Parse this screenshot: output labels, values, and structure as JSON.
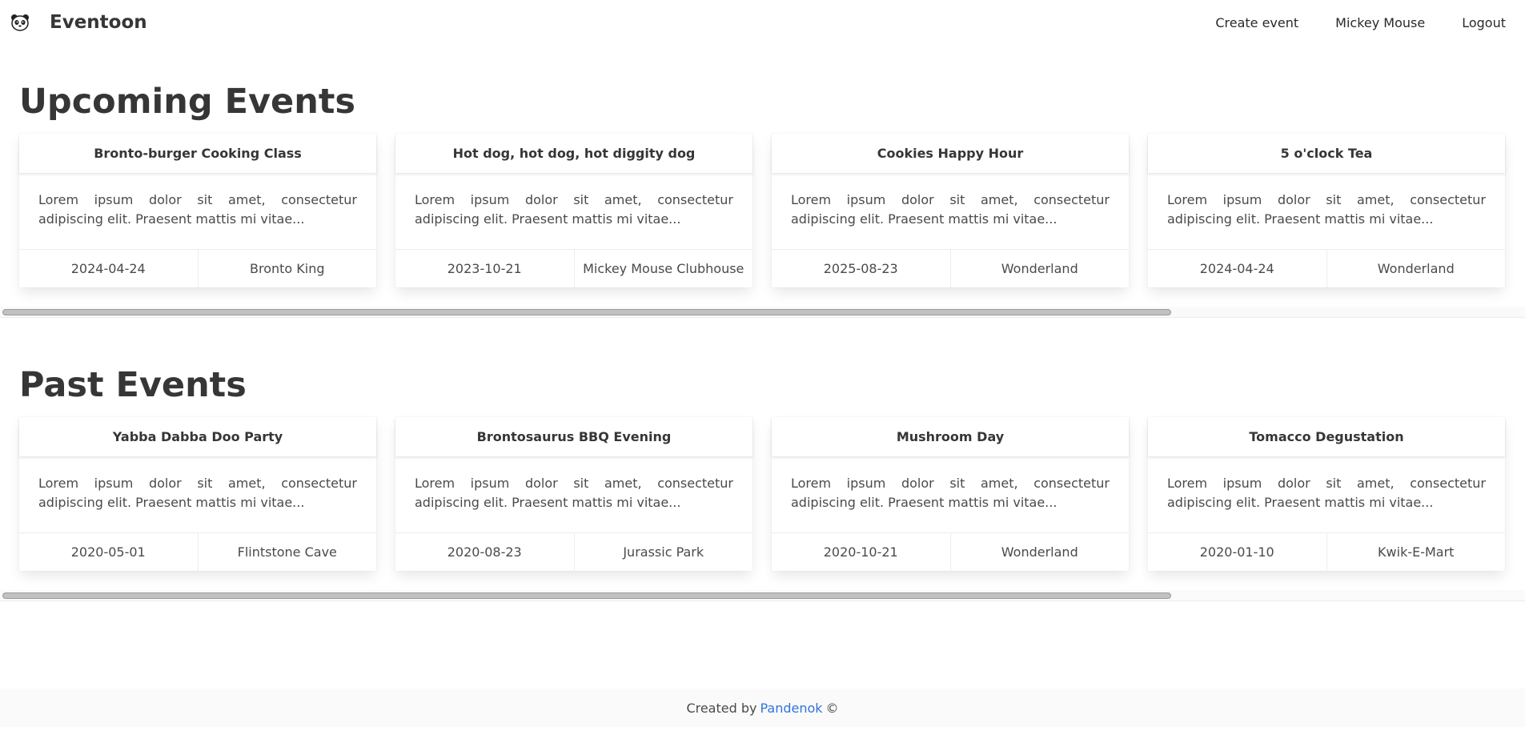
{
  "app": {
    "name": "Eventoon",
    "logo_icon": "panda-icon"
  },
  "nav": {
    "create_event": "Create event",
    "user": "Mickey Mouse",
    "logout": "Logout"
  },
  "upcoming": {
    "title": "Upcoming Events",
    "events": [
      {
        "title": "Bronto-burger Cooking Class",
        "description": "Lorem ipsum dolor sit amet, consectetur adipiscing elit. Praesent mattis mi vitae...",
        "date": "2024-04-24",
        "location": "Bronto King"
      },
      {
        "title": "Hot dog, hot dog, hot diggity dog",
        "description": "Lorem ipsum dolor sit amet, consectetur adipiscing elit. Praesent mattis mi vitae...",
        "date": "2023-10-21",
        "location": "Mickey Mouse Clubhouse"
      },
      {
        "title": "Cookies Happy Hour",
        "description": "Lorem ipsum dolor sit amet, consectetur adipiscing elit. Praesent mattis mi vitae...",
        "date": "2025-08-23",
        "location": "Wonderland"
      },
      {
        "title": "5 o'clock Tea",
        "description": "Lorem ipsum dolor sit amet, consectetur adipiscing elit. Praesent mattis mi vitae...",
        "date": "2024-04-24",
        "location": "Wonderland"
      }
    ]
  },
  "past": {
    "title": "Past Events",
    "events": [
      {
        "title": "Yabba Dabba Doo Party",
        "description": "Lorem ipsum dolor sit amet, consectetur adipiscing elit. Praesent mattis mi vitae...",
        "date": "2020-05-01",
        "location": "Flintstone Cave"
      },
      {
        "title": "Brontosaurus BBQ Evening",
        "description": "Lorem ipsum dolor sit amet, consectetur adipiscing elit. Praesent mattis mi vitae...",
        "date": "2020-08-23",
        "location": "Jurassic Park"
      },
      {
        "title": "Mushroom Day",
        "description": "Lorem ipsum dolor sit amet, consectetur adipiscing elit. Praesent mattis mi vitae...",
        "date": "2020-10-21",
        "location": "Wonderland"
      },
      {
        "title": "Tomacco Degustation",
        "description": "Lorem ipsum dolor sit amet, consectetur adipiscing elit. Praesent mattis mi vitae...",
        "date": "2020-01-10",
        "location": "Kwik-E-Mart"
      }
    ]
  },
  "footer": {
    "created_by": "Created by",
    "author": "Pandenok",
    "copyright": "©"
  },
  "colors": {
    "link": "#3273dc",
    "text": "#363636",
    "footer_bg": "#fafafa"
  }
}
